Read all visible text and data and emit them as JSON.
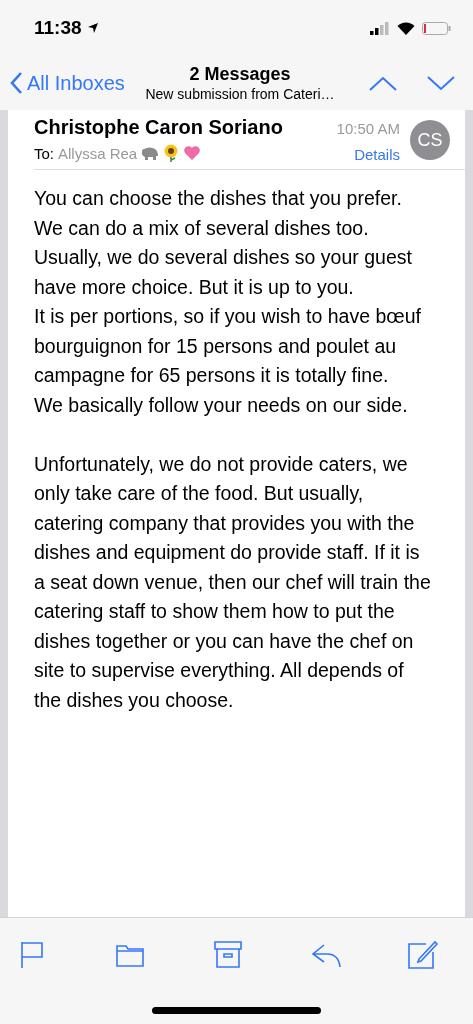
{
  "status_bar": {
    "time": "11:38"
  },
  "nav": {
    "back": "All Inboxes",
    "title": "2 Messages",
    "subtitle": "New submission from Cateri…"
  },
  "message": {
    "sender": "Christophe Caron Soriano",
    "time": "10:50 AM",
    "to_label": "To:",
    "recipient": "Allyssa Rea",
    "details": "Details",
    "avatar": "CS",
    "paragraphs": [
      "You can choose the dishes that you prefer. We can do a mix of several dishes too. Usually, we do several dishes so your guest have more choice. But it is up to you.",
      "It is per portions, so if you wish to have bœuf bourguignon for 15 persons and poulet au campagne for 65 persons it is totally fine.",
      "We basically follow your needs on our side.",
      "Unfortunately, we do not provide caters, we only take care of the food.  But usually, catering company that provides you with the dishes and equipment do provide staff. If it is a seat down venue, then our chef will train the catering staff to show them how to put the dishes together or you can have the chef on  site to supervise everything. All depends of the dishes you choose."
    ]
  },
  "toolbar": [
    {
      "kind": "flag"
    },
    {
      "kind": "folder"
    },
    {
      "kind": "archive"
    },
    {
      "kind": "reply"
    },
    {
      "kind": "compose"
    }
  ]
}
